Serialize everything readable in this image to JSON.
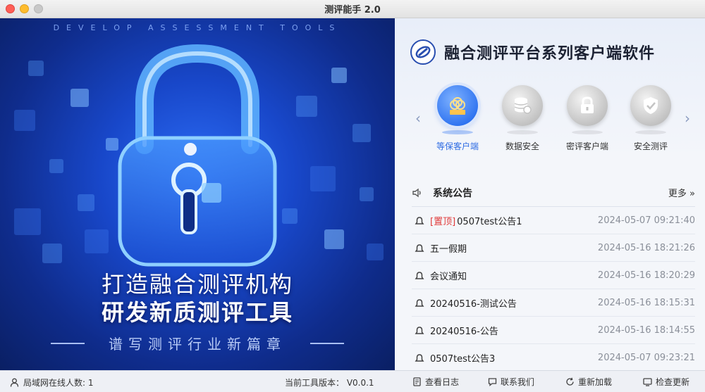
{
  "window": {
    "title": "测评能手 2.0"
  },
  "banner": {
    "tagline": "DEVELOP ASSESSMENT TOOLS",
    "line1": "打造融合测评机构",
    "line2": "研发新质测评工具",
    "line3": "谱写测评行业新篇章"
  },
  "brand": {
    "title": "融合测评平台系列客户端软件"
  },
  "carousel": {
    "items": [
      {
        "label": "等保客户端",
        "icon": "djcp-icon",
        "active": true
      },
      {
        "label": "数据安全",
        "icon": "database-icon",
        "active": false
      },
      {
        "label": "密评客户端",
        "icon": "lock-icon",
        "active": false
      },
      {
        "label": "安全测评",
        "icon": "shield-icon",
        "active": false
      }
    ]
  },
  "notices": {
    "title": "系统公告",
    "more": "更多 »",
    "items": [
      {
        "pin": "[置顶]",
        "text": "0507test公告1",
        "time": "2024-05-07 09:21:40"
      },
      {
        "pin": "",
        "text": "五一假期",
        "time": "2024-05-16 18:21:26"
      },
      {
        "pin": "",
        "text": "会议通知",
        "time": "2024-05-16 18:20:29"
      },
      {
        "pin": "",
        "text": "20240516-测试公告",
        "time": "2024-05-16 18:15:31"
      },
      {
        "pin": "",
        "text": "20240516-公告",
        "time": "2024-05-16 18:14:55"
      },
      {
        "pin": "",
        "text": "0507test公告3",
        "time": "2024-05-07 09:23:21"
      }
    ]
  },
  "statusbar": {
    "online": "局域网在线人数: 1",
    "version": "当前工具版本： V0.0.1",
    "log": "查看日志",
    "contact": "联系我们",
    "reload": "重新加载",
    "update": "检查更新"
  },
  "colors": {
    "accent": "#2d6be3",
    "pin": "#e03a3a",
    "banner_dark": "#0f2c8c"
  }
}
